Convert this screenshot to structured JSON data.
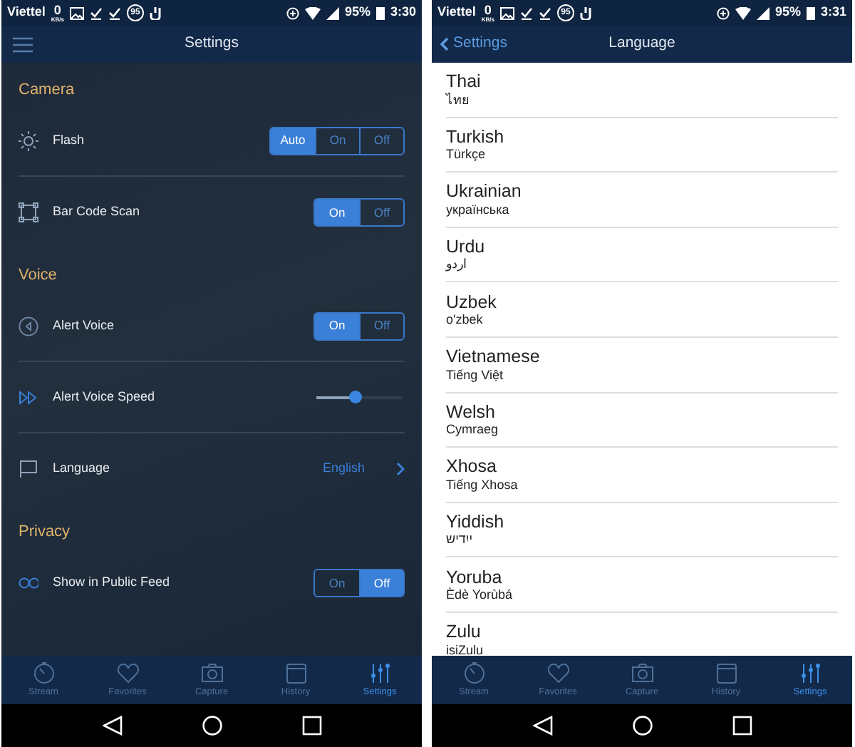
{
  "screens": [
    {
      "kind": "settings",
      "status_bar": {
        "carrier": "Viettel",
        "speed": "0",
        "speed_unit": "KB/s",
        "badge": "95",
        "battery": "95%",
        "time": "3:30"
      },
      "app_bar": {
        "title": "Settings"
      },
      "sections": [
        {
          "title": "Camera",
          "items": [
            {
              "kind": "segmented",
              "label": "Flash",
              "options": [
                {
                  "label": "Auto",
                  "selected": true
                },
                {
                  "label": "On",
                  "selected": false
                },
                {
                  "label": "Off",
                  "selected": false
                }
              ]
            },
            {
              "kind": "segmented",
              "label": "Bar Code Scan",
              "options": [
                {
                  "label": "On",
                  "selected": true
                },
                {
                  "label": "Off",
                  "selected": false
                }
              ]
            }
          ]
        },
        {
          "title": "Voice",
          "items": [
            {
              "kind": "segmented",
              "label": "Alert Voice",
              "options": [
                {
                  "label": "On",
                  "selected": true
                },
                {
                  "label": "Off",
                  "selected": false
                }
              ]
            },
            {
              "kind": "slider",
              "label": "Alert Voice Speed",
              "level": 0.45
            },
            {
              "kind": "link",
              "label": "Language",
              "value": "English"
            }
          ]
        },
        {
          "title": "Privacy",
          "items": [
            {
              "kind": "segmented",
              "label": "Show in Public Feed",
              "options": [
                {
                  "label": "On",
                  "selected": false
                },
                {
                  "label": "Off",
                  "selected": true
                }
              ]
            }
          ]
        }
      ],
      "tabs": [
        {
          "label": "Stream",
          "selected": false
        },
        {
          "label": "Favorites",
          "selected": false
        },
        {
          "label": "Capture",
          "selected": false
        },
        {
          "label": "History",
          "selected": false
        },
        {
          "label": "Settings",
          "selected": true
        }
      ]
    },
    {
      "kind": "languages",
      "status_bar": {
        "carrier": "Viettel",
        "speed": "0",
        "speed_unit": "KB/s",
        "badge": "95",
        "battery": "95%",
        "time": "3:31"
      },
      "app_bar": {
        "title": "Language",
        "back_label": "Settings"
      },
      "languages": [
        {
          "name": "Thai",
          "native": "ไทย"
        },
        {
          "name": "Turkish",
          "native": "Türkçe"
        },
        {
          "name": "Ukrainian",
          "native": "українська"
        },
        {
          "name": "Urdu",
          "native": "اردو"
        },
        {
          "name": "Uzbek",
          "native": "o'zbek"
        },
        {
          "name": "Vietnamese",
          "native": "Tiếng Việt"
        },
        {
          "name": "Welsh",
          "native": "Cymraeg"
        },
        {
          "name": "Xhosa",
          "native": "Tiếng Xhosa"
        },
        {
          "name": "Yiddish",
          "native": "ייִדיש"
        },
        {
          "name": "Yoruba",
          "native": "Èdè Yorùbá"
        },
        {
          "name": "Zulu",
          "native": "isiZulu"
        }
      ],
      "tabs": [
        {
          "label": "Stream",
          "selected": false
        },
        {
          "label": "Favorites",
          "selected": false
        },
        {
          "label": "Capture",
          "selected": false
        },
        {
          "label": "History",
          "selected": false
        },
        {
          "label": "Settings",
          "selected": true
        }
      ]
    }
  ]
}
